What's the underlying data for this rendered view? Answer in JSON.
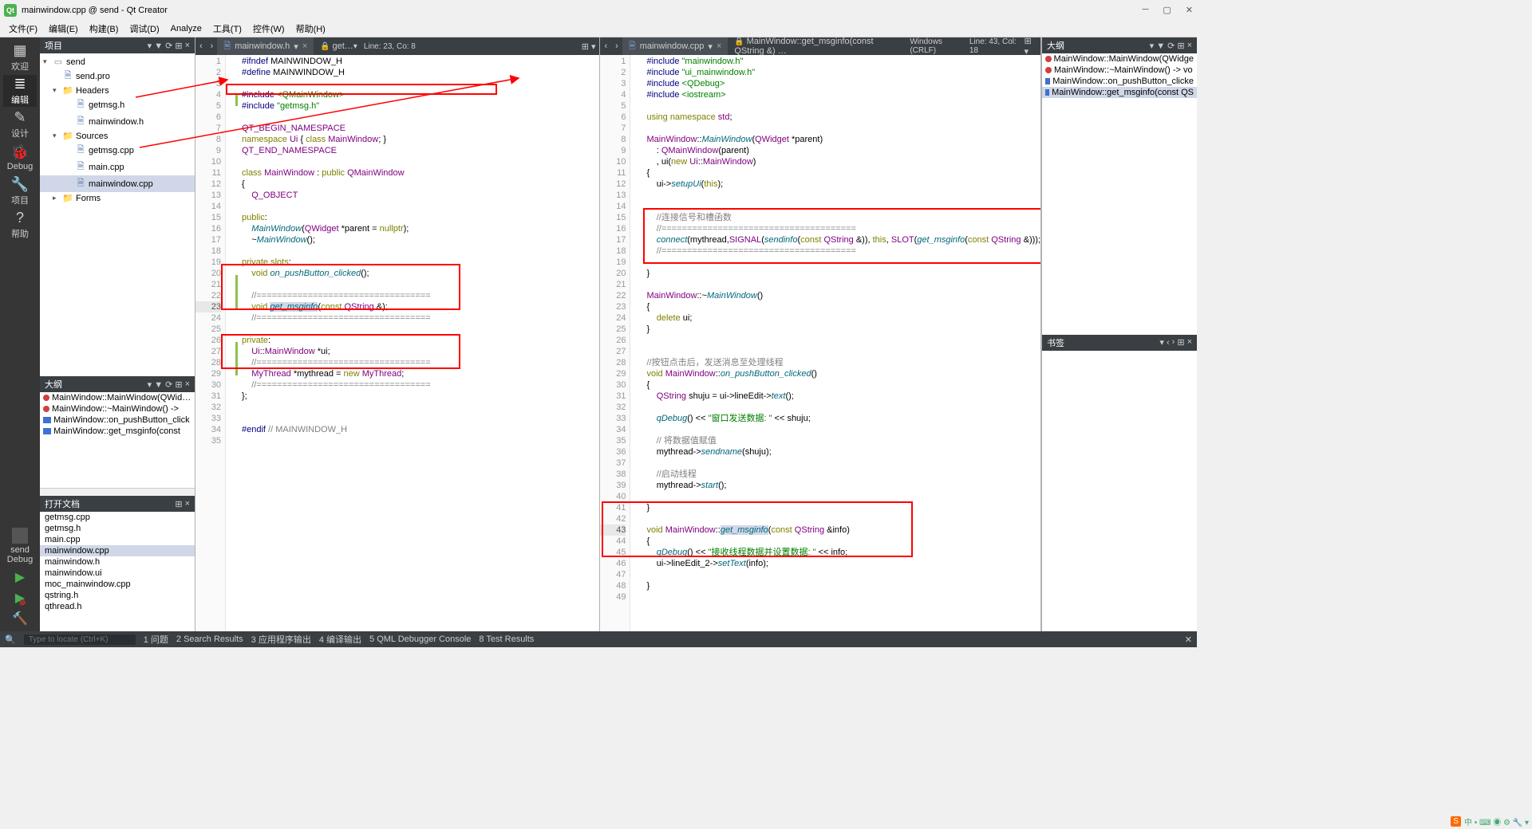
{
  "window": {
    "title": "mainwindow.cpp @ send - Qt Creator"
  },
  "menu": [
    "文件(F)",
    "编辑(E)",
    "构建(B)",
    "调试(D)",
    "Analyze",
    "工具(T)",
    "控件(W)",
    "帮助(H)"
  ],
  "sidebar": [
    {
      "icon": "⋮⋮⋮",
      "label": "欢迎"
    },
    {
      "icon": "≣",
      "label": "编辑",
      "active": true
    },
    {
      "icon": "✎",
      "label": "设计"
    },
    {
      "icon": "🐞",
      "label": "Debug"
    },
    {
      "icon": "🔧",
      "label": "项目"
    },
    {
      "icon": "?",
      "label": "帮助"
    }
  ],
  "project_panel": {
    "title": "项目",
    "tree": [
      {
        "lvl": 0,
        "chev": "▾",
        "icon": "proj",
        "name": "send"
      },
      {
        "lvl": 1,
        "chev": "",
        "icon": "file",
        "name": "send.pro"
      },
      {
        "lvl": 1,
        "chev": "▾",
        "icon": "folder",
        "name": "Headers"
      },
      {
        "lvl": 2,
        "chev": "",
        "icon": "file",
        "name": "getmsg.h"
      },
      {
        "lvl": 2,
        "chev": "",
        "icon": "file",
        "name": "mainwindow.h"
      },
      {
        "lvl": 1,
        "chev": "▾",
        "icon": "folder",
        "name": "Sources"
      },
      {
        "lvl": 2,
        "chev": "",
        "icon": "file",
        "name": "getmsg.cpp"
      },
      {
        "lvl": 2,
        "chev": "",
        "icon": "file",
        "name": "main.cpp"
      },
      {
        "lvl": 2,
        "chev": "",
        "icon": "file",
        "name": "mainwindow.cpp",
        "selected": true
      },
      {
        "lvl": 1,
        "chev": "▸",
        "icon": "folder",
        "name": "Forms"
      }
    ]
  },
  "outline_left": {
    "title": "大纲",
    "items": [
      {
        "icon": "red",
        "text": "MainWindow::MainWindow(QWid…"
      },
      {
        "icon": "red",
        "text": "MainWindow::~MainWindow() ->"
      },
      {
        "icon": "blue",
        "text": "MainWindow::on_pushButton_click"
      },
      {
        "icon": "blue",
        "text": "MainWindow::get_msginfo(const"
      }
    ]
  },
  "opendocs": {
    "title": "打开文档",
    "items": [
      {
        "name": "getmsg.cpp"
      },
      {
        "name": "getmsg.h"
      },
      {
        "name": "main.cpp"
      },
      {
        "name": "mainwindow.cpp",
        "selected": true
      },
      {
        "name": "mainwindow.h"
      },
      {
        "name": "mainwindow.ui"
      },
      {
        "name": "moc_mainwindow.cpp"
      },
      {
        "name": "qstring.h"
      },
      {
        "name": "qthread.h"
      }
    ]
  },
  "left_editor": {
    "tab": "mainwindow.h",
    "crumb": "get…",
    "pos": "Line: 23, Co: 8",
    "first_line": 1
  },
  "right_editor": {
    "tab": "mainwindow.cpp",
    "crumb": "MainWindow::get_msginfo(const QString &) …",
    "enc": "Windows (CRLF)",
    "pos": "Line: 43, Col: 18",
    "first_line": 1
  },
  "outline_right": {
    "title": "大纲",
    "items": [
      {
        "icon": "red",
        "text": "MainWindow::MainWindow(QWidge"
      },
      {
        "icon": "red",
        "text": "MainWindow::~MainWindow() -> vo"
      },
      {
        "icon": "blue",
        "text": "MainWindow::on_pushButton_clicke"
      },
      {
        "icon": "blue",
        "text": "MainWindow::get_msginfo(const QS",
        "selected": true
      }
    ]
  },
  "bookmarks": {
    "title": "书签"
  },
  "status": {
    "search_ph": "Type to locate (Ctrl+K)",
    "items": [
      "1 问题",
      "2 Search Results",
      "3 应用程序输出",
      "4 编译输出",
      "5 QML Debugger Console",
      "8 Test Results"
    ]
  },
  "run_badge": {
    "name": "send",
    "mode": "Debug"
  }
}
